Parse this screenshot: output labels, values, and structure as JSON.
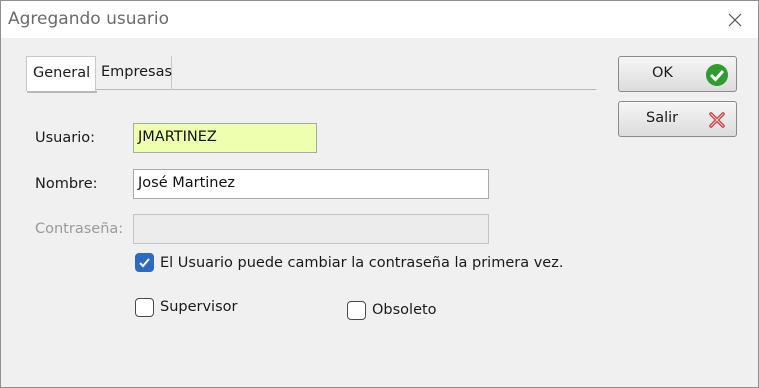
{
  "window": {
    "title": "Agregando usuario",
    "close_icon": "close-icon"
  },
  "tabs": [
    {
      "label": "General",
      "active": true
    },
    {
      "label": "Empresas",
      "active": false
    }
  ],
  "form": {
    "usuario": {
      "label": "Usuario:",
      "value": "JMARTINEZ",
      "bg_color": "#efffb0"
    },
    "nombre": {
      "label": "Nombre:",
      "value": "José Martinez"
    },
    "contrasena": {
      "label": "Contraseña:",
      "value": "",
      "disabled": true
    },
    "puede_cambiar": {
      "label": "El Usuario puede cambiar la contraseña la primera vez.",
      "checked": true
    },
    "supervisor": {
      "label": "Supervisor",
      "checked": false
    },
    "obsoleto": {
      "label": "Obsoleto",
      "checked": false
    }
  },
  "buttons": {
    "ok": {
      "label": "OK",
      "icon": "checkmark-icon",
      "icon_color": "#2e9c2e"
    },
    "salir": {
      "label": "Salir",
      "icon": "x-icon",
      "icon_color": "#c8363f"
    }
  },
  "colors": {
    "accent_checkbox": "#2d6bc2"
  }
}
